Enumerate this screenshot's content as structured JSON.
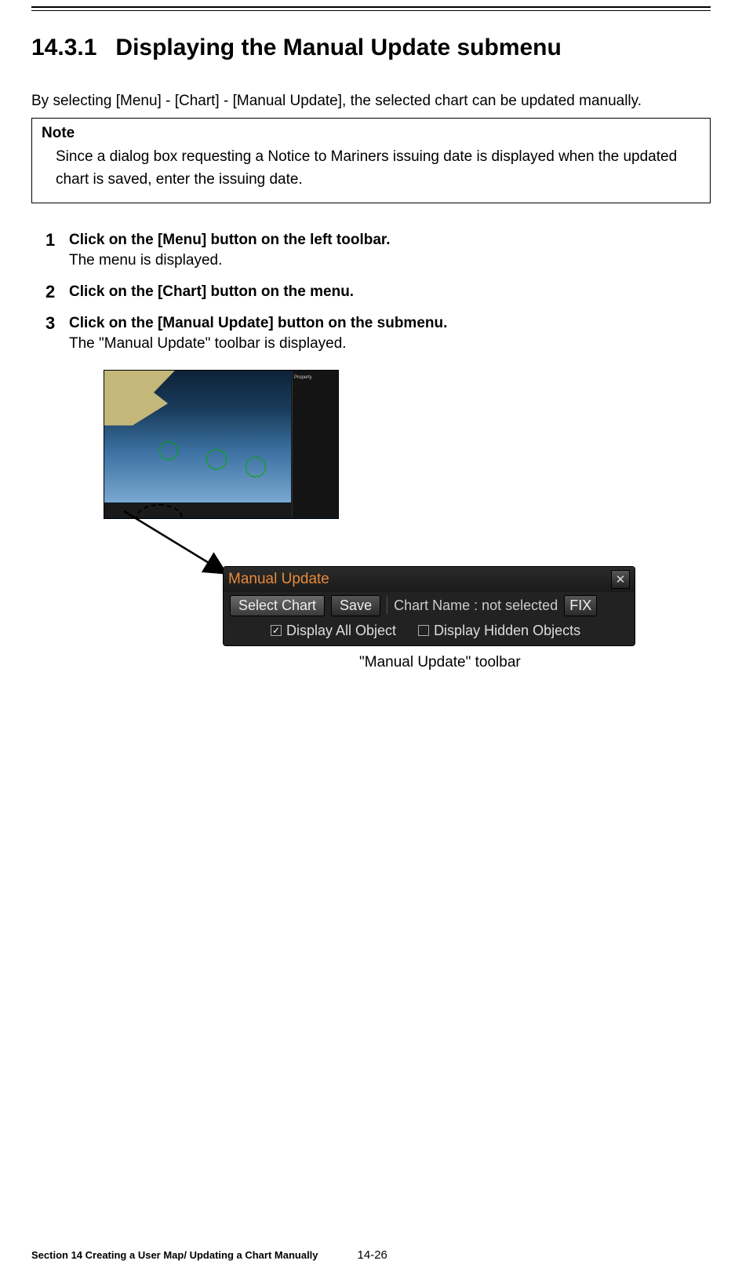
{
  "heading": {
    "number": "14.3.1",
    "title": "Displaying the Manual Update submenu"
  },
  "intro": "By selecting [Menu] - [Chart] - [Manual Update], the selected chart can be updated manually.",
  "note": {
    "title": "Note",
    "text": "Since a dialog box requesting a Notice to Mariners issuing date is displayed when the updated chart is saved, enter the issuing date."
  },
  "steps": [
    {
      "head": "Click on the [Menu] button on the left toolbar.",
      "body": "The menu is displayed."
    },
    {
      "head": "Click on the [Chart] button on the menu.",
      "body": ""
    },
    {
      "head": "Click on the [Manual Update] button on the submenu.",
      "body": "The \"Manual Update\" toolbar is displayed."
    }
  ],
  "toolbar": {
    "title": "Manual Update",
    "select_chart": "Select Chart",
    "save": "Save",
    "chart_name_label": "Chart Name :",
    "chart_name_value": "not selected",
    "fix": "FIX",
    "display_all": "Display All Object",
    "display_hidden": "Display Hidden Objects",
    "display_all_checked": true,
    "display_hidden_checked": false
  },
  "caption": "\"Manual Update\" toolbar",
  "footer": {
    "section": "Section 14    Creating a User Map/ Updating a Chart Manually",
    "page": "14-26"
  }
}
